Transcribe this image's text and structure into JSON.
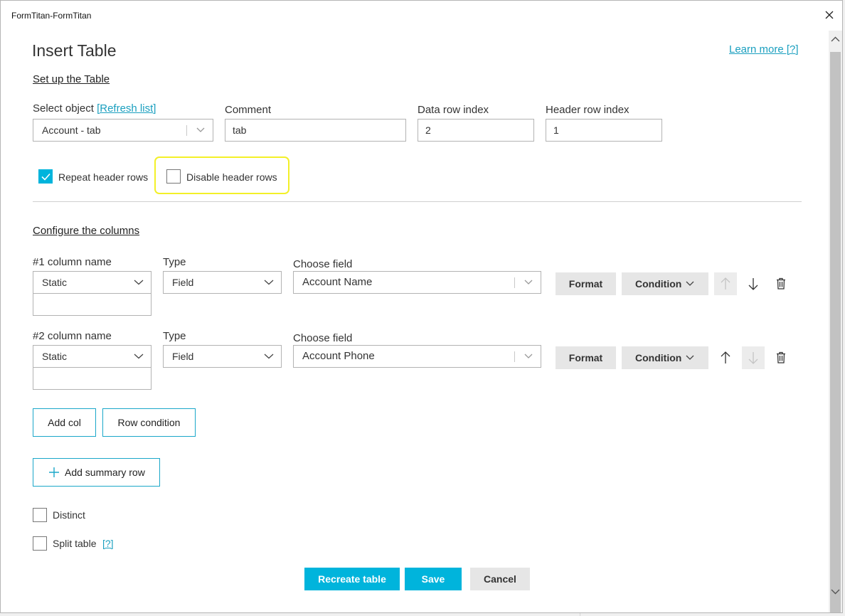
{
  "window": {
    "title": "FormTitan-FormTitan"
  },
  "header": {
    "title": "Insert Table",
    "learn_more": "Learn more [?]"
  },
  "setup": {
    "section_title": "Set up the Table",
    "select_object_label": "Select object",
    "refresh_link": "[Refresh list]",
    "select_object_value": "Account - tab",
    "comment_label": "Comment",
    "comment_value": "tab",
    "data_row_index_label": "Data row index",
    "data_row_index_value": "2",
    "header_row_index_label": "Header row index",
    "header_row_index_value": "1",
    "repeat_header_rows": {
      "label": "Repeat header rows",
      "checked": true
    },
    "disable_header_rows": {
      "label": "Disable header rows",
      "checked": false
    }
  },
  "columns": {
    "section_title": "Configure the columns",
    "items": [
      {
        "name_label": "#1 column name",
        "name_mode": "Static",
        "name_value": "",
        "type_label": "Type",
        "type_value": "Field",
        "field_label": "Choose field",
        "field_value": "Account Name",
        "format_label": "Format",
        "condition_label": "Condition",
        "move_up_enabled": false,
        "move_down_enabled": true
      },
      {
        "name_label": "#2 column name",
        "name_mode": "Static",
        "name_value": "",
        "type_label": "Type",
        "type_value": "Field",
        "field_label": "Choose field",
        "field_value": "Account Phone",
        "format_label": "Format",
        "condition_label": "Condition",
        "move_up_enabled": true,
        "move_down_enabled": false
      }
    ],
    "add_col": "Add col",
    "row_condition": "Row condition",
    "add_summary_row": "Add summary row"
  },
  "options": {
    "distinct": {
      "label": "Distinct",
      "checked": false
    },
    "split_table": {
      "label": "Split table",
      "checked": false,
      "help": "[?]"
    }
  },
  "footer": {
    "recreate": "Recreate table",
    "save": "Save",
    "cancel": "Cancel"
  },
  "colors": {
    "accent": "#00b4dc",
    "link": "#1a9fbf",
    "highlight": "#f3f028"
  }
}
